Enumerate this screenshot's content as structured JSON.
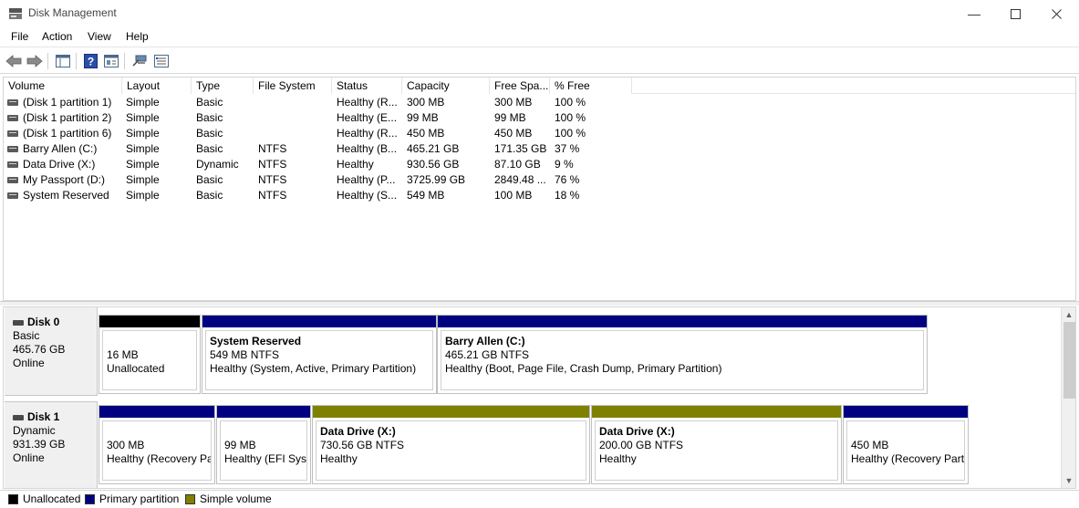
{
  "window": {
    "title": "Disk Management"
  },
  "menu": [
    "File",
    "Action",
    "View",
    "Help"
  ],
  "toolbar": [
    "back-icon",
    "forward-icon",
    "show-hide-console-tree-icon",
    "help-icon",
    "properties-icon",
    "connect-icon",
    "settings-icon"
  ],
  "volumes": {
    "columns": [
      "Volume",
      "Layout",
      "Type",
      "File System",
      "Status",
      "Capacity",
      "Free Spa...",
      "% Free"
    ],
    "rows": [
      [
        "(Disk 1 partition 1)",
        "Simple",
        "Basic",
        "",
        "Healthy (R...",
        "300 MB",
        "300 MB",
        "100 %"
      ],
      [
        "(Disk 1 partition 2)",
        "Simple",
        "Basic",
        "",
        "Healthy (E...",
        "99 MB",
        "99 MB",
        "100 %"
      ],
      [
        "(Disk 1 partition 6)",
        "Simple",
        "Basic",
        "",
        "Healthy (R...",
        "450 MB",
        "450 MB",
        "100 %"
      ],
      [
        "Barry Allen (C:)",
        "Simple",
        "Basic",
        "NTFS",
        "Healthy (B...",
        "465.21 GB",
        "171.35 GB",
        "37 %"
      ],
      [
        "Data Drive (X:)",
        "Simple",
        "Dynamic",
        "NTFS",
        "Healthy",
        "930.56 GB",
        "87.10 GB",
        "9 %"
      ],
      [
        "My Passport (D:)",
        "Simple",
        "Basic",
        "NTFS",
        "Healthy (P...",
        "3725.99 GB",
        "2849.48 ...",
        "76 %"
      ],
      [
        "System Reserved",
        "Simple",
        "Basic",
        "NTFS",
        "Healthy (S...",
        "549 MB",
        "100 MB",
        "18 %"
      ]
    ]
  },
  "disks": [
    {
      "name": "Disk 0",
      "type": "Basic",
      "size": "465.76 GB",
      "state": "Online",
      "partitions": [
        {
          "name": "",
          "size": "16 MB",
          "status": "Unallocated",
          "kind": "unallocated"
        },
        {
          "name": "System Reserved",
          "size": "549 MB NTFS",
          "status": "Healthy (System, Active, Primary Partition)",
          "kind": "primary"
        },
        {
          "name": "Barry Allen  (C:)",
          "size": "465.21 GB NTFS",
          "status": "Healthy (Boot, Page File, Crash Dump, Primary Partition)",
          "kind": "primary"
        }
      ]
    },
    {
      "name": "Disk 1",
      "type": "Dynamic",
      "size": "931.39 GB",
      "state": "Online",
      "partitions": [
        {
          "name": "",
          "size": "300 MB",
          "status": "Healthy (Recovery Pa",
          "kind": "primary"
        },
        {
          "name": "",
          "size": "99 MB",
          "status": "Healthy (EFI Syst",
          "kind": "primary"
        },
        {
          "name": "Data Drive  (X:)",
          "size": "730.56 GB NTFS",
          "status": "Healthy",
          "kind": "simple"
        },
        {
          "name": "Data Drive  (X:)",
          "size": "200.00 GB NTFS",
          "status": "Healthy",
          "kind": "simple"
        },
        {
          "name": "",
          "size": "450 MB",
          "status": "Healthy (Recovery Parti",
          "kind": "primary"
        }
      ]
    }
  ],
  "legend": [
    {
      "label": "Unallocated",
      "color": "#000000"
    },
    {
      "label": "Primary partition",
      "color": "#000080"
    },
    {
      "label": "Simple volume",
      "color": "#808000"
    }
  ],
  "colors": {
    "unallocated": "#000000",
    "primary": "#000080",
    "simple": "#808000"
  }
}
